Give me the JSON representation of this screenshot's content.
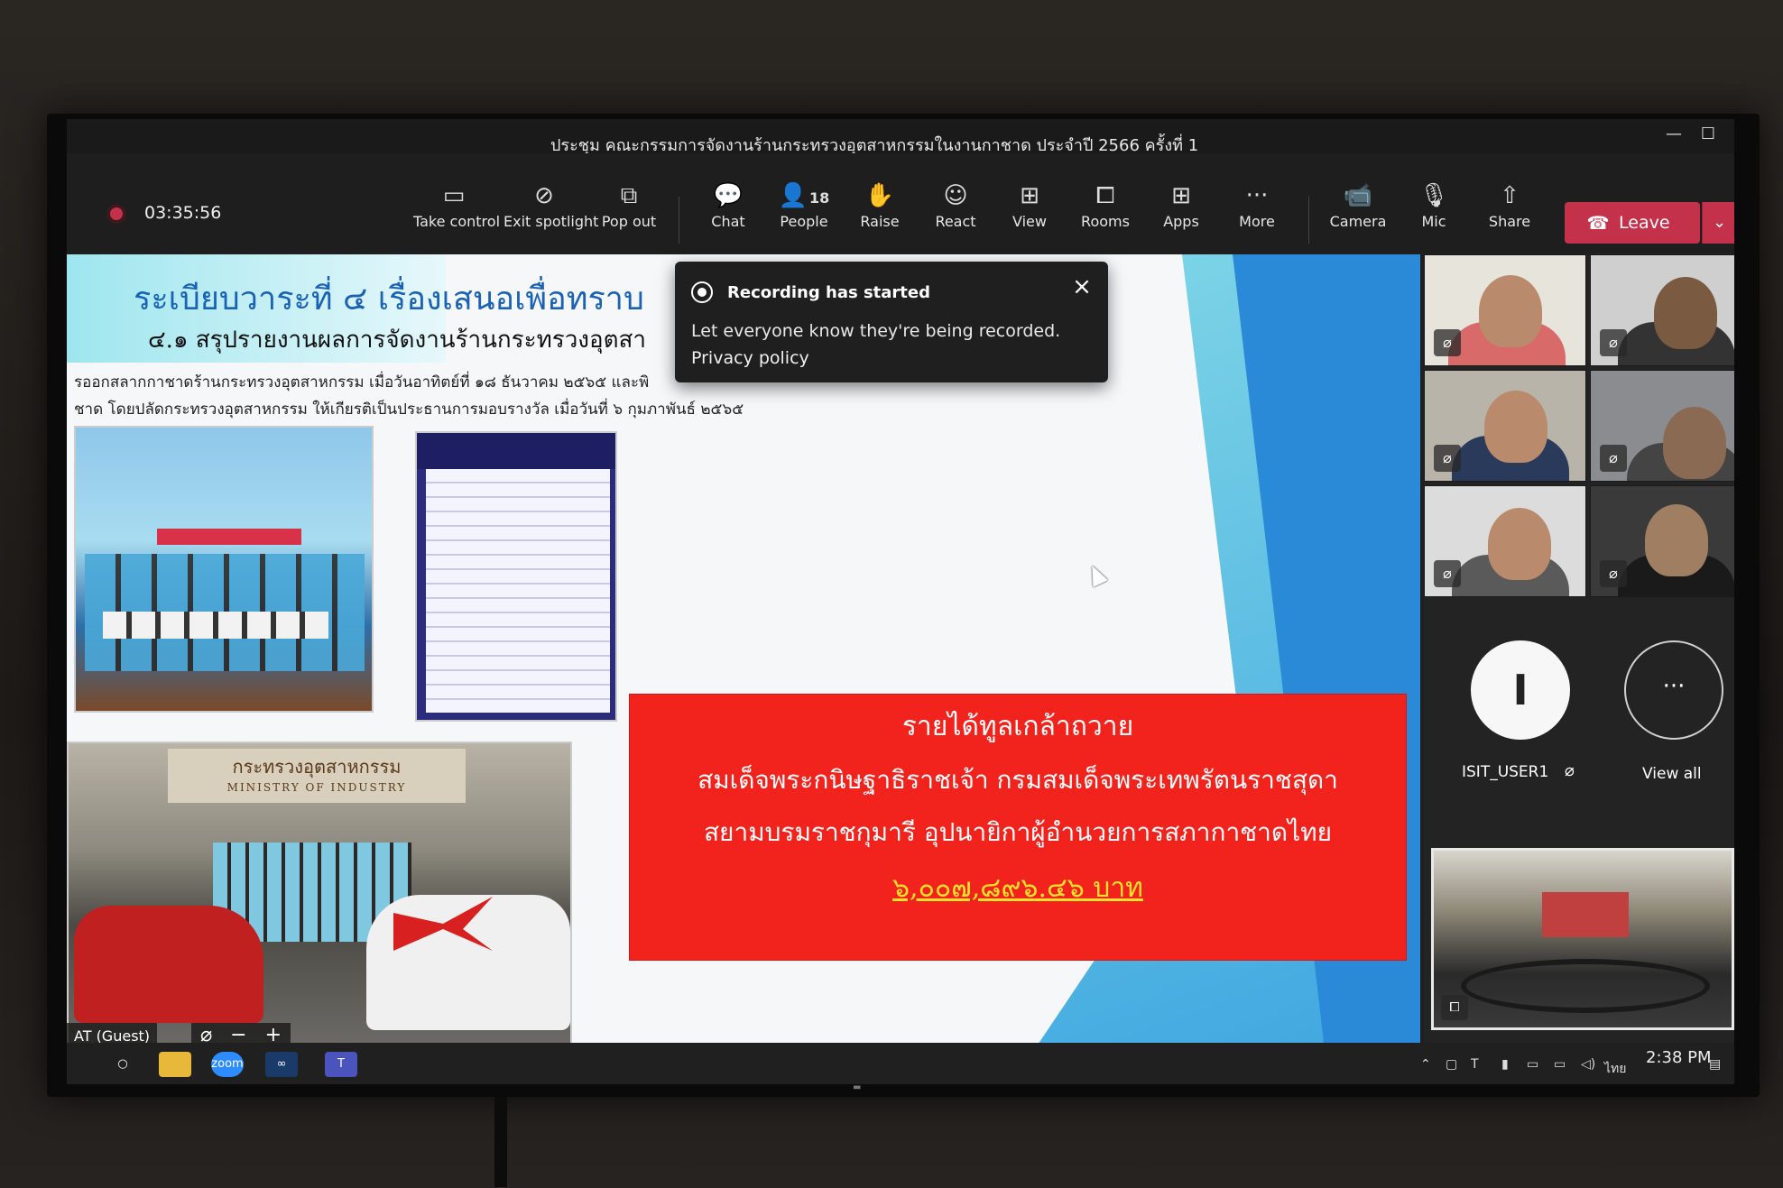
{
  "window": {
    "title": "ประชุม คณะกรรมการจัดงานร้านกระทรวงอุตสาหกรรมในงานกาชาด ประจำปี 2566 ครั้งที่ 1"
  },
  "recording": {
    "elapsed": "03:35:56"
  },
  "toolbar": {
    "take_control": "Take control",
    "exit_spotlight": "Exit spotlight",
    "pop_out": "Pop out",
    "chat": "Chat",
    "people": "People",
    "people_count": "18",
    "raise": "Raise",
    "react": "React",
    "view": "View",
    "rooms": "Rooms",
    "apps": "Apps",
    "more": "More",
    "camera": "Camera",
    "mic": "Mic",
    "share": "Share",
    "leave": "Leave"
  },
  "toast": {
    "title": "Recording has started",
    "body": "Let everyone know they're being recorded.",
    "link": "Privacy policy"
  },
  "slide": {
    "heading": "ระเบียบวาระที่ ๔ เรื่องเสนอเพื่อทราบ",
    "subheading": "๔.๑ สรุปรายงานผลการจัดงานร้านกระทรวงอุตสา",
    "line1": "รออกสลากกาชาดร้านกระทรวงอุตสาหกรรม เมื่อวันอาทิตย์ที่ ๑๘ ธันวาคม ๒๕๖๕ และพิ",
    "line2": "ชาด โดยปลัดกระทรวงอุตสาหกรรม ให้เกียรติเป็นประธานการมอบรางวัล เมื่อวันที่ ๖ กุมภาพันธ์ ๒๕๖๕",
    "photo_sign_th": "กระทรวงอุตสาหกรรม",
    "photo_sign_en": "MINISTRY OF INDUSTRY",
    "red_title": "รายได้ทูลเกล้าถวาย",
    "red_line2": "สมเด็จพระกนิษฐาธิราชเจ้า กรมสมเด็จพระเทพรัตนราชสุดา",
    "red_line3": "สยามบรมราชกุมารี อุปนายิกาผู้อำนวยการสภากาชาดไทย",
    "amount": "๖,๐๐๗,๘๙๖.๔๖ บาท",
    "guest_label": "AT (Guest)"
  },
  "participants": {
    "user1_initial": "I",
    "user1_name": "ISIT_USER1",
    "view_all_dots": "···",
    "view_all": "View all"
  },
  "taskbar": {
    "zoom": "zoom",
    "lang": "ไทย",
    "time": "2:38 PM"
  },
  "colors": {
    "leave": "#c4314b",
    "amount": "#ffe12a",
    "redbox": "#f2221c"
  }
}
